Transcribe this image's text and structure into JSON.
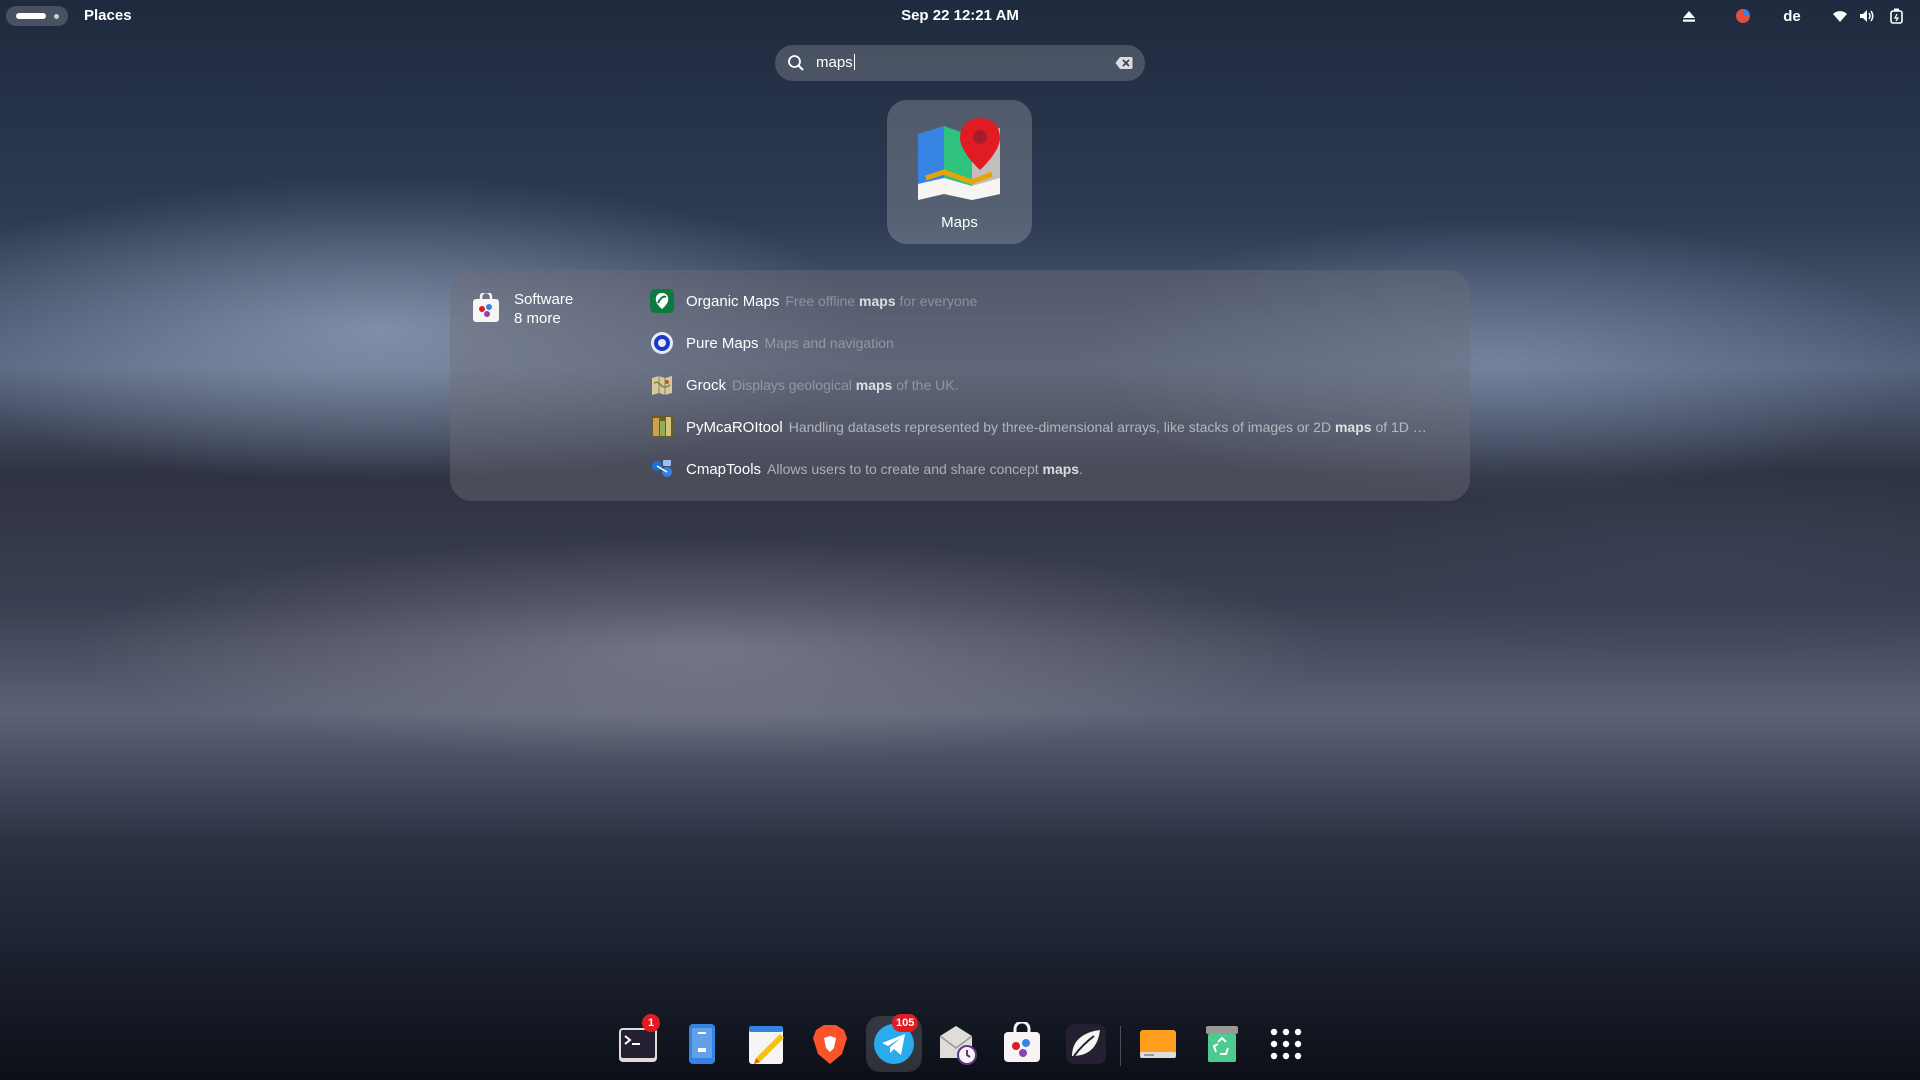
{
  "topbar": {
    "places_label": "Places",
    "clock": "Sep 22  12:21 AM",
    "keyboard_layout": "de"
  },
  "search": {
    "query": "maps"
  },
  "app_results": [
    {
      "name": "Maps",
      "icon": "maps-app-icon"
    }
  ],
  "software_provider": {
    "name": "Software",
    "more": "8 more",
    "results": [
      {
        "name": "Organic Maps",
        "desc_parts": [
          "Free offline ",
          "maps",
          " for everyone"
        ],
        "icon": "organic-maps-icon"
      },
      {
        "name": "Pure Maps",
        "desc_parts": [
          "Maps and navigation",
          "",
          ""
        ],
        "icon": "pure-maps-icon"
      },
      {
        "name": "Grock",
        "desc_parts": [
          "Displays geological ",
          "maps",
          " of the UK."
        ],
        "icon": "grock-icon"
      },
      {
        "name": "PyMcaROItool",
        "desc_parts": [
          "Handling datasets represented by three-dimensional arrays, like stacks of images or 2D ",
          "maps",
          " of 1D …"
        ],
        "icon": "pymcaroitool-icon"
      },
      {
        "name": "CmapTools",
        "desc_parts": [
          "Allows users to to create and share concept ",
          "maps",
          "."
        ],
        "icon": "cmaptools-icon"
      }
    ]
  },
  "dock": {
    "items": [
      {
        "name": "terminal",
        "badge": "1"
      },
      {
        "name": "phone-mirror",
        "badge": ""
      },
      {
        "name": "text-editor",
        "badge": ""
      },
      {
        "name": "brave-browser",
        "badge": ""
      },
      {
        "name": "telegram",
        "badge": "105"
      },
      {
        "name": "mail-scheduler",
        "badge": ""
      },
      {
        "name": "software-store",
        "badge": ""
      },
      {
        "name": "leaf-app",
        "badge": ""
      },
      {
        "name": "files-drive",
        "badge": ""
      },
      {
        "name": "trash",
        "badge": ""
      },
      {
        "name": "show-apps",
        "badge": ""
      }
    ]
  },
  "colors": {
    "badge": "#e01b24",
    "accent_blue": "#3584e4"
  }
}
